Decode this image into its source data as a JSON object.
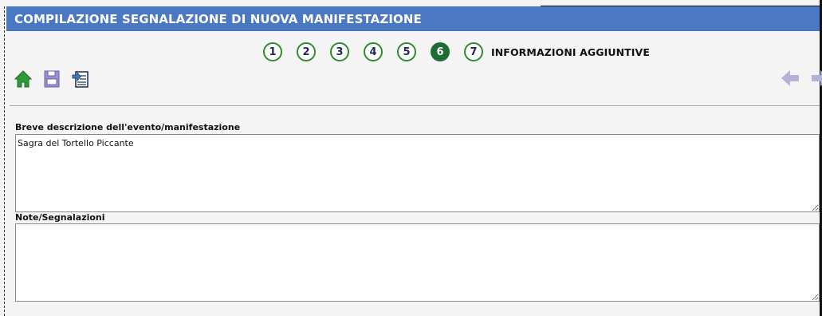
{
  "header": {
    "title": "COMPILAZIONE SEGNALAZIONE DI NUOVA MANIFESTAZIONE"
  },
  "wizard": {
    "steps": [
      "1",
      "2",
      "3",
      "4",
      "5",
      "6",
      "7"
    ],
    "current_step": "6",
    "current_step_title": "INFORMAZIONI AGGIUNTIVE"
  },
  "toolbar": {
    "icons": [
      "home-icon",
      "save-icon",
      "export-icon"
    ]
  },
  "navigation": {
    "icons": [
      "arrow-left-icon",
      "arrow-right-icon"
    ]
  },
  "form": {
    "description_label": "Breve descrizione dell'evento/manifestazione",
    "description_value": "Sagra del Tortello Piccante",
    "notes_label": "Note/Segnalazioni",
    "notes_value": ""
  },
  "colors": {
    "title_bar": "#4a78c2",
    "step_border": "#2e8b2e",
    "step_active": "#1e6b34",
    "nav_arrow": "#b3b3d9"
  }
}
